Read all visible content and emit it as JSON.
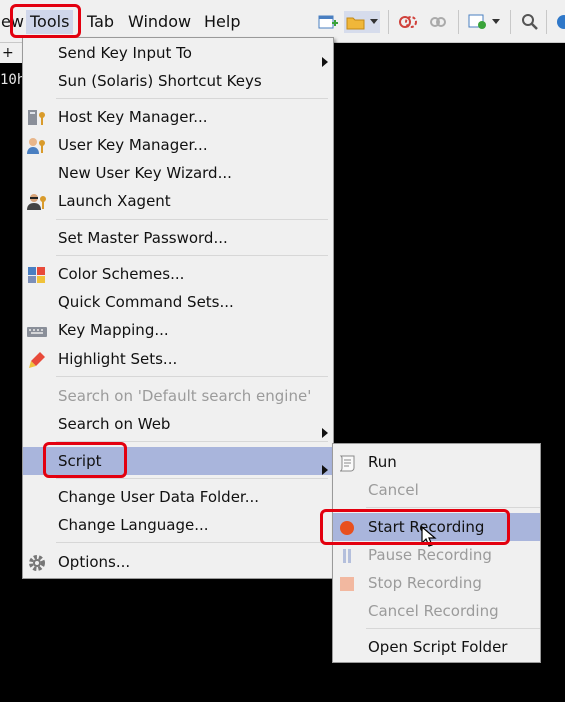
{
  "menubar": {
    "items": [
      {
        "id": "view",
        "label": "ew"
      },
      {
        "id": "tools",
        "label": "Tools"
      },
      {
        "id": "tab",
        "label": "Tab"
      },
      {
        "id": "window",
        "label": "Window"
      },
      {
        "id": "help",
        "label": "Help"
      }
    ]
  },
  "toolbar": {
    "icons": [
      "new-session-icon",
      "open-folder-icon",
      "dropdown-icon",
      "disconnect-icon",
      "link-icon",
      "settings-icon",
      "dropdown-icon",
      "search-icon",
      "globe-icon"
    ]
  },
  "terminal": {
    "tab_label": "+",
    "text": "10h"
  },
  "tools_menu": {
    "items": [
      {
        "label": "Send Key Input To",
        "submenu": true
      },
      {
        "label": "Sun (Solaris) Shortcut Keys"
      },
      {
        "label": "Host Key Manager...",
        "icon": "host-key-icon"
      },
      {
        "label": "User Key Manager...",
        "icon": "user-key-icon"
      },
      {
        "label": "New User Key Wizard..."
      },
      {
        "label": "Launch Xagent",
        "icon": "agent-icon"
      },
      {
        "label": "Set Master Password..."
      },
      {
        "label": "Color Schemes...",
        "icon": "color-schemes-icon"
      },
      {
        "label": "Quick Command Sets..."
      },
      {
        "label": "Key Mapping...",
        "icon": "keyboard-icon"
      },
      {
        "label": "Highlight Sets...",
        "icon": "highlighter-icon"
      },
      {
        "label": "Search on 'Default search engine'",
        "disabled": true
      },
      {
        "label": "Search on Web",
        "submenu": true
      },
      {
        "label": "Script",
        "submenu": true,
        "highlighted": true
      },
      {
        "label": "Change User Data Folder..."
      },
      {
        "label": "Change Language..."
      },
      {
        "label": "Options...",
        "icon": "gear-icon"
      }
    ]
  },
  "script_submenu": {
    "items": [
      {
        "label": "Run",
        "icon": "script-scroll-icon"
      },
      {
        "label": "Cancel",
        "disabled": true
      },
      {
        "label": "Start Recording",
        "icon": "record-icon",
        "highlighted": true
      },
      {
        "label": "Pause Recording",
        "icon": "pause-icon",
        "disabled": true
      },
      {
        "label": "Stop Recording",
        "icon": "stop-icon",
        "disabled": true
      },
      {
        "label": "Cancel Recording",
        "disabled": true
      },
      {
        "label": "Open Script Folder"
      }
    ]
  },
  "colors": {
    "highlight": "#a9b5dc",
    "annotation": "#e3000f",
    "record": "#e8501e",
    "disabled_text": "#9b9b9b"
  }
}
